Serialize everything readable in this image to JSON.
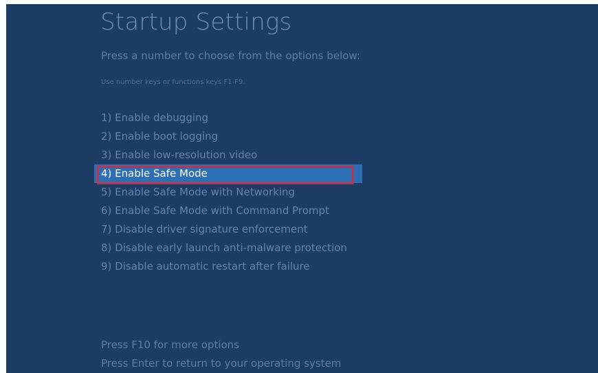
{
  "screen": {
    "title": "Startup Settings",
    "subtitle": "Press a number to choose from the options below:",
    "hint": "Use number keys or functions keys F1-F9."
  },
  "options": [
    {
      "label": "1) Enable debugging"
    },
    {
      "label": "2) Enable boot logging"
    },
    {
      "label": "3) Enable low-resolution video"
    },
    {
      "label": "4) Enable Safe Mode",
      "selected": true
    },
    {
      "label": "5) Enable Safe Mode with Networking"
    },
    {
      "label": "6) Enable Safe Mode with Command Prompt"
    },
    {
      "label": "7) Disable driver signature enforcement"
    },
    {
      "label": "8) Disable early launch anti-malware protection"
    },
    {
      "label": "9) Disable automatic restart after failure"
    }
  ],
  "footer": {
    "more_options": "Press F10 for more options",
    "return": "Press Enter to return to your operating system"
  },
  "colors": {
    "background": "#1c3c64",
    "selection": "#2c6fb4",
    "highlight_box": "#c0334b",
    "text_dim": "#6584ab",
    "text_selected": "#ffffff"
  }
}
